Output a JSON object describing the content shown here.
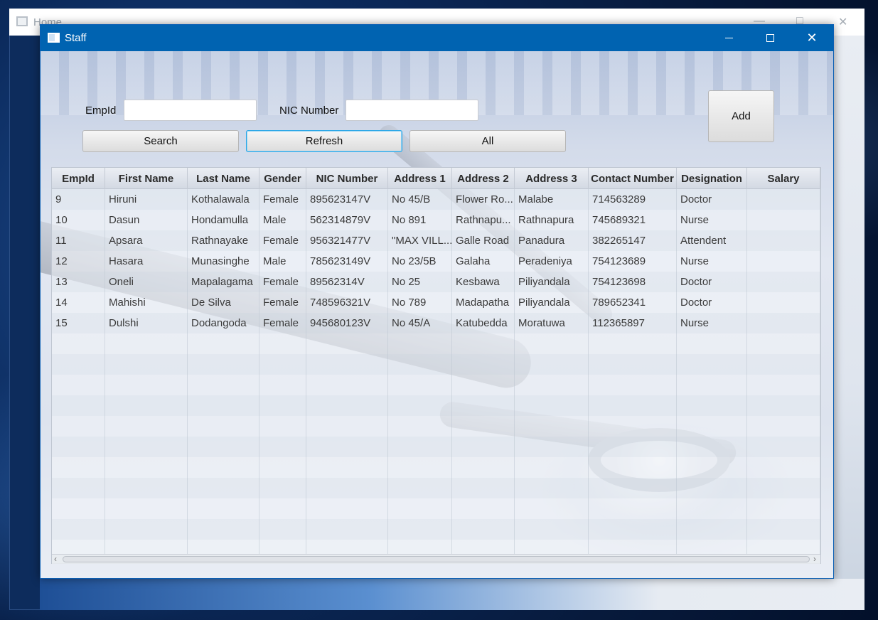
{
  "background_window": {
    "title": "Home"
  },
  "window": {
    "title": "Staff"
  },
  "form": {
    "empid_label": "EmpId",
    "empid_value": "",
    "nic_label": "NIC Number",
    "nic_value": "",
    "add_label": "Add",
    "search_label": "Search",
    "refresh_label": "Refresh",
    "all_label": "All"
  },
  "table": {
    "columns": [
      "EmpId",
      "First Name",
      "Last Name",
      "Gender",
      "NIC Number",
      "Address 1",
      "Address 2",
      "Address 3",
      "Contact Number",
      "Designation",
      "Salary"
    ],
    "rows": [
      [
        "9",
        "Hiruni",
        "Kothalawala",
        "Female",
        "895623147V",
        "No 45/B",
        "Flower Ro...",
        "Malabe",
        "714563289",
        "Doctor",
        ""
      ],
      [
        "10",
        "Dasun",
        "Hondamulla",
        "Male",
        "562314879V",
        "No 891",
        "Rathnapu...",
        "Rathnapura",
        "745689321",
        "Nurse",
        ""
      ],
      [
        "11",
        "Apsara",
        "Rathnayake",
        "Female",
        "956321477V",
        "\"MAX VILL...",
        "Galle Road",
        "Panadura",
        "382265147",
        "Attendent",
        ""
      ],
      [
        "12",
        "Hasara",
        "Munasinghe",
        "Male",
        "785623149V",
        "No 23/5B",
        "Galaha",
        "Peradeniya",
        "754123689",
        "Nurse",
        ""
      ],
      [
        "13",
        "Oneli",
        "Mapalagama",
        "Female",
        "89562314V",
        "No 25",
        "Kesbawa",
        "Piliyandala",
        "754123698",
        "Doctor",
        ""
      ],
      [
        "14",
        "Mahishi",
        "De Silva",
        "Female",
        "748596321V",
        "No 789",
        "Madapatha",
        "Piliyandala",
        "789652341",
        "Doctor",
        ""
      ],
      [
        "15",
        "Dulshi",
        "Dodangoda",
        "Female",
        "945680123V",
        "No 45/A",
        "Katubedda",
        "Moratuwa",
        "112365897",
        "Nurse",
        ""
      ]
    ],
    "empty_rows": 11
  },
  "icons": {
    "app": "window-app-icon",
    "minimize": "minimize-icon",
    "maximize": "maximize-icon",
    "close": "close-icon",
    "scroll_left": "chevron-left-icon",
    "scroll_right": "chevron-right-icon"
  },
  "colors": {
    "titlebar": "#0063b1",
    "focus_border": "#2aa6e6"
  }
}
